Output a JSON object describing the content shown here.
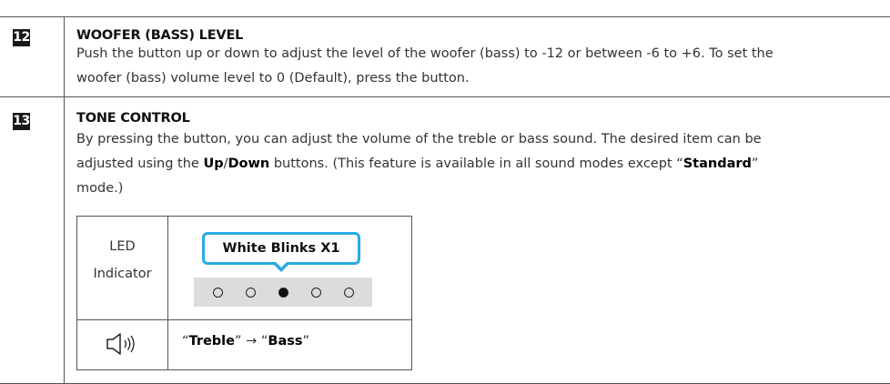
{
  "items": [
    {
      "number": "12",
      "title": "WOOFER (BASS) LEVEL",
      "lines": [
        "Push the button up or down to adjust the level of the woofer (bass) to -12 or between -6 to +6. To set the",
        "woofer (bass) volume level to 0 (Default), press the button."
      ]
    },
    {
      "number": "13",
      "title": "TONE CONTROL",
      "line1": "By pressing the button, you can adjust the volume of the treble or bass sound. The desired item can be",
      "line2": {
        "pre": "adjusted using the ",
        "up": "Up",
        "slash": "/",
        "down": "Down",
        "mid": " buttons. (This feature is available in all sound modes except “",
        "standard": "Standard",
        "post": "”"
      },
      "line3": "mode.)"
    }
  ],
  "led_table": {
    "label_line1": "LED",
    "label_line2": "Indicator",
    "callout": "White Blinks X1",
    "leds": [
      false,
      false,
      true,
      false,
      false
    ],
    "sound": {
      "open_quote": "“",
      "treble": "Treble",
      "close_quote": "”",
      "arrow": " → ",
      "bass": "Bass"
    },
    "speaker_icon": "speaker-icon"
  }
}
